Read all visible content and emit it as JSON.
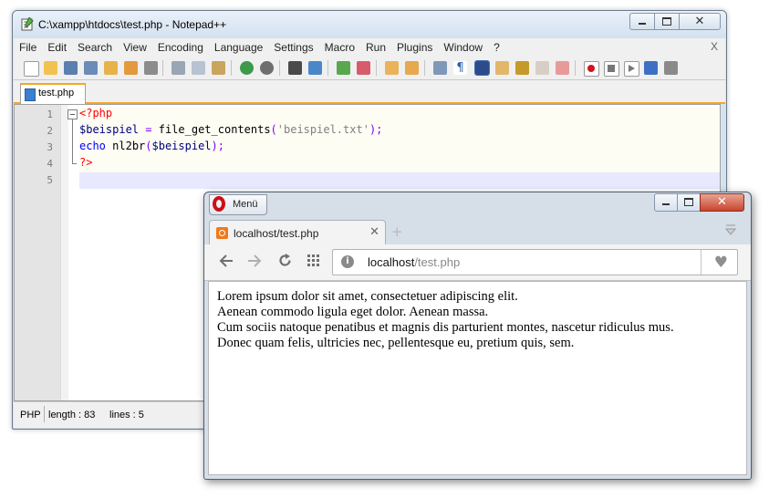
{
  "notepad": {
    "title": "C:\\xampp\\htdocs\\test.php - Notepad++",
    "window_controls": [
      "minimize",
      "maximize",
      "close"
    ],
    "menu": [
      "File",
      "Edit",
      "Search",
      "View",
      "Encoding",
      "Language",
      "Settings",
      "Macro",
      "Run",
      "Plugins",
      "Window",
      "?"
    ],
    "menu_close": "X",
    "tab_label": "test.php",
    "line_numbers": [
      "1",
      "2",
      "3",
      "4",
      "5"
    ],
    "code": {
      "l1_tag": "<?php",
      "l2_var": "$beispiel",
      "l2_eq": " = ",
      "l2_fn": "file_get_contents",
      "l2_open": "(",
      "l2_str": "'beispiel.txt'",
      "l2_close": ");",
      "l3_kw": "echo",
      "l3_sp": " ",
      "l3_fn": "nl2br",
      "l3_open": "(",
      "l3_var": "$beispiel",
      "l3_close": ");",
      "l4_tag": "?>"
    },
    "status": {
      "lang": "PHP",
      "length": "length : 83",
      "lines": "lines : 5"
    },
    "colors": {
      "tag": "#ff0000",
      "variable": "#000080",
      "operator": "#8000ff",
      "string": "#808080",
      "keyword": "#0000ff",
      "tab_accent": "#f6a623"
    }
  },
  "opera": {
    "menu_label": "Menü",
    "tab_label": "localhost/test.php",
    "tab_close": "✕",
    "new_tab": "+",
    "url_host": "localhost",
    "url_path": "/test.php",
    "nav_icons": [
      "back-icon",
      "forward-icon",
      "reload-icon",
      "speed-dial-icon"
    ],
    "content_lines": [
      "Lorem ipsum dolor sit amet, consectetuer adipiscing elit.",
      "Aenean commodo ligula eget dolor. Aenean massa.",
      "Cum sociis natoque penatibus et magnis dis parturient montes, nascetur ridiculus mus.",
      "Donec quam felis, ultricies nec, pellentesque eu, pretium quis, sem."
    ]
  }
}
